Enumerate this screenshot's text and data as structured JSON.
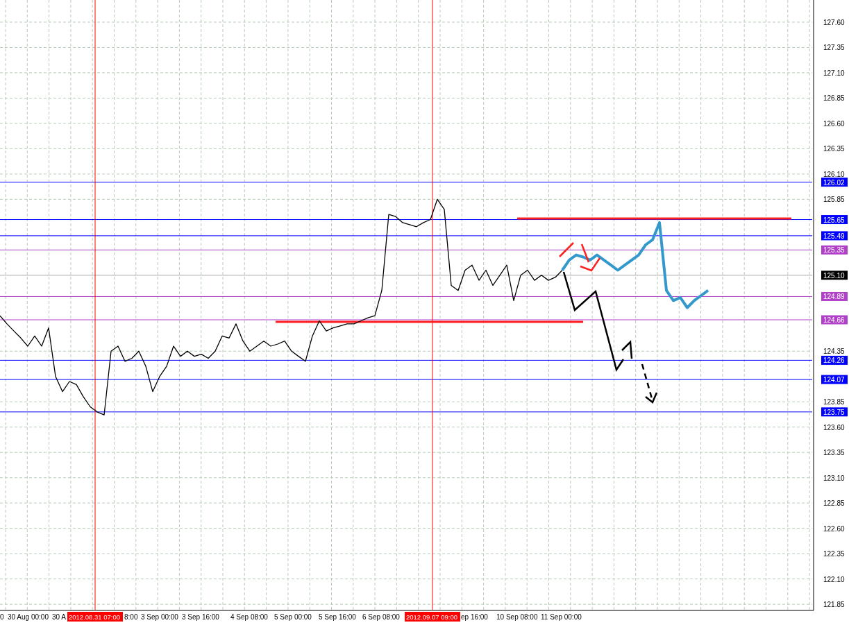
{
  "chart": {
    "chart_data": {
      "type": "line",
      "grid": true,
      "series": [
        {
          "color": "#000000",
          "values": [
            124.7,
            124.62,
            124.55,
            124.48,
            124.4,
            124.5,
            124.4,
            124.58,
            124.1,
            123.95,
            124.05,
            124.02,
            123.9,
            123.8,
            123.75,
            123.72,
            124.35,
            124.4,
            124.25,
            124.28,
            124.35,
            124.2,
            123.95,
            124.1,
            124.2,
            124.4,
            124.3,
            124.35,
            124.3,
            124.32,
            124.28,
            124.35,
            124.5,
            124.48,
            124.62,
            124.45,
            124.35,
            124.4,
            124.45,
            124.4,
            124.42,
            124.45,
            124.35,
            124.3,
            124.25,
            124.5,
            124.65,
            124.55,
            124.58,
            124.6,
            124.62,
            124.62,
            124.65,
            124.68,
            124.7,
            124.95,
            125.7,
            125.68,
            125.62,
            125.6,
            125.58,
            125.62,
            125.65,
            125.85,
            125.75,
            125.0,
            124.95,
            125.15,
            125.2,
            125.05,
            125.15,
            125.0,
            125.1,
            125.2,
            124.85,
            125.1,
            125.15,
            125.05,
            125.1,
            125.05,
            125.08,
            125.15,
            null,
            null,
            null,
            null,
            null,
            null,
            null,
            null,
            null,
            null,
            null,
            null,
            null,
            null,
            null,
            null,
            null,
            null,
            null,
            null,
            null
          ]
        },
        {
          "color": "#3399cc",
          "values": [
            null,
            null,
            null,
            null,
            null,
            null,
            null,
            null,
            null,
            null,
            null,
            null,
            null,
            null,
            null,
            null,
            null,
            null,
            null,
            null,
            null,
            null,
            null,
            null,
            null,
            null,
            null,
            null,
            null,
            null,
            null,
            null,
            null,
            null,
            null,
            null,
            null,
            null,
            null,
            null,
            null,
            null,
            null,
            null,
            null,
            null,
            null,
            null,
            null,
            null,
            null,
            null,
            null,
            null,
            null,
            null,
            null,
            null,
            null,
            null,
            null,
            null,
            null,
            null,
            null,
            null,
            null,
            null,
            null,
            null,
            null,
            null,
            null,
            null,
            null,
            null,
            null,
            null,
            null,
            null,
            null,
            125.15,
            125.25,
            125.3,
            125.28,
            125.25,
            125.3,
            125.25,
            125.2,
            125.15,
            125.2,
            125.25,
            125.3,
            125.4,
            125.45,
            125.62,
            124.95,
            124.85,
            124.88,
            124.78,
            124.85,
            124.9,
            124.95
          ]
        }
      ],
      "ylim": [
        121.789,
        127.819
      ],
      "yticks": [
        {
          "value": 127.6,
          "label": "127.60"
        },
        {
          "value": 127.35,
          "label": "127.35"
        },
        {
          "value": 127.1,
          "label": "127.10"
        },
        {
          "value": 126.85,
          "label": "126.85"
        },
        {
          "value": 126.6,
          "label": "126.60"
        },
        {
          "value": 126.35,
          "label": "126.35"
        },
        {
          "value": 126.1,
          "label": "126.10"
        },
        {
          "value": 125.85,
          "label": "125.85"
        },
        {
          "value": 124.35,
          "label": "124.35"
        },
        {
          "value": 123.85,
          "label": "123.85"
        },
        {
          "value": 123.6,
          "label": "123.60"
        },
        {
          "value": 123.35,
          "label": "123.35"
        },
        {
          "value": 123.1,
          "label": "123.10"
        },
        {
          "value": 122.85,
          "label": "122.85"
        },
        {
          "value": 122.6,
          "label": "122.60"
        },
        {
          "value": 122.35,
          "label": "122.35"
        },
        {
          "value": 122.1,
          "label": "122.10"
        },
        {
          "value": 121.85,
          "label": "121.85"
        }
      ],
      "ref_lines": [
        {
          "axis": "y",
          "value": 126.02,
          "label": "126.02",
          "color": "#0000ff"
        },
        {
          "axis": "y",
          "value": 125.65,
          "label": "125.65",
          "color": "#0000ff"
        },
        {
          "axis": "y",
          "value": 125.49,
          "label": "125.49",
          "color": "#0000ff"
        },
        {
          "axis": "y",
          "value": 125.35,
          "label": "125.35",
          "color": "#b040c8"
        },
        {
          "axis": "y",
          "value": 125.1,
          "label": "125.10",
          "color": "#000000"
        },
        {
          "axis": "y",
          "value": 124.89,
          "label": "124.89",
          "color": "#b040c8"
        },
        {
          "axis": "y",
          "value": 124.66,
          "label": "124.66",
          "color": "#b040c8"
        },
        {
          "axis": "y",
          "value": 124.26,
          "label": "124.26",
          "color": "#0000ff"
        },
        {
          "axis": "y",
          "value": 124.07,
          "label": "124.07",
          "color": "#0000ff"
        },
        {
          "axis": "y",
          "value": 123.75,
          "label": "123.75",
          "color": "#0000ff"
        },
        {
          "axis": "y",
          "value": 124.64,
          "color": "#ff2020"
        },
        {
          "axis": "y",
          "value": 125.66,
          "color": "#ff2020"
        }
      ]
    },
    "time_axis": [
      "0",
      "30 Aug 00:00",
      "30 A",
      "8:00",
      "3 Sep 00:00",
      "3 Sep 16:00",
      "4 Sep 08:00",
      "5 Sep 00:00",
      "5 Sep 16:00",
      "6 Sep 08:00",
      "ep 16:00",
      "10 Sep 08:00",
      "11 Sep 00:00"
    ],
    "time_markers": [
      {
        "label": "2012.08.31 07:00"
      },
      {
        "label": "2012.09.07 09:00"
      }
    ]
  }
}
